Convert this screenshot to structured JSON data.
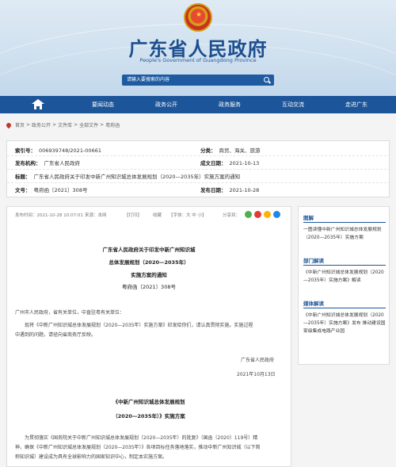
{
  "header": {
    "title": "广东省人民政府",
    "subtitle": "People's Government of Guangdong Province",
    "search_placeholder": "请输入要搜索的内容"
  },
  "nav": {
    "items": [
      "要闻动态",
      "政务公开",
      "政务服务",
      "互动交流",
      "走进广东"
    ]
  },
  "breadcrumb": [
    "首页",
    "政务公开",
    "文件库",
    "全部文件",
    "粤府函"
  ],
  "meta": {
    "index_label": "索引号：",
    "index_value": "006939748/2021-00661",
    "category_label": "分类：",
    "category_value": "商贸、海关、旅游",
    "issuer_label": "发布机构：",
    "issuer_value": "广东省人民政府",
    "date_label": "成文日期：",
    "date_value": "2021-10-13",
    "title_label": "标题：",
    "title_value": "广东省人民政府关于印发中新广州知识城总体发展规划（2020—2035年）实施方案的通知",
    "docno_label": "文号：",
    "docno_value": "粤府函〔2021〕308号",
    "pub_label": "发布日期：",
    "pub_value": "2021-10-28"
  },
  "toolbar": {
    "time": "发布时间：2021-10-28 10:07:01",
    "source": "来源：本网",
    "print": "【打印】",
    "collect": "收藏",
    "font": "【字体：大  中  小】",
    "share": "分享到：",
    "share_colors": [
      "#4caf50",
      "#e53935",
      "#ffb300",
      "#1e88e5"
    ]
  },
  "article": {
    "head1": "广东省人民政府关于印发中新广州知识城",
    "head2": "总体发展规划（2020—2035年）",
    "head3": "实施方案的通知",
    "head4": "粤府函〔2021〕308号",
    "salutation": "广州市人民政府，省有关单位，中直驻粤有关单位：",
    "body1a": "现将《中新广州知识城总体发展规划（2020—2035年）实施方案》印发给你们，请认真贯彻实施。实施过程",
    "body1b": "中遇到的问题，请径向省商务厅反映。",
    "sign": "广东省人民政府",
    "sign_date": "2021年10月13日",
    "sub1": "《中新广州知识城总体发展规划",
    "sub2": "（2020—2035年）》实施方案",
    "body2a": "为贯彻落实《国务院关于中新广州知识城总体发展规划（2020—2035年）的批复》（国函〔2020〕119号）精",
    "body2b": "神，确保《中新广州知识城总体发展规划（2020—2035年）》各项目标任务落地落实，推动中新广州知识城（以下简",
    "body2c": "称知识城）建设成为具有全球影响力的国家知识中心，制定本实施方案。"
  },
  "sidebar": {
    "s1_title": "图解",
    "s1_item": "一图读懂中新广州知识城总体发展规划（2020—2035年）实施方案",
    "s2_title": "部门解读",
    "s2_item": "《中新广州知识城总体发展规划（2020—2035年）实施方案》解读",
    "s3_title": "媒体解读",
    "s3_item": "《中新广州知识城总体发展规划（2020—2035年）实施方案》发布 推动建设国家级集成电路产业园"
  }
}
